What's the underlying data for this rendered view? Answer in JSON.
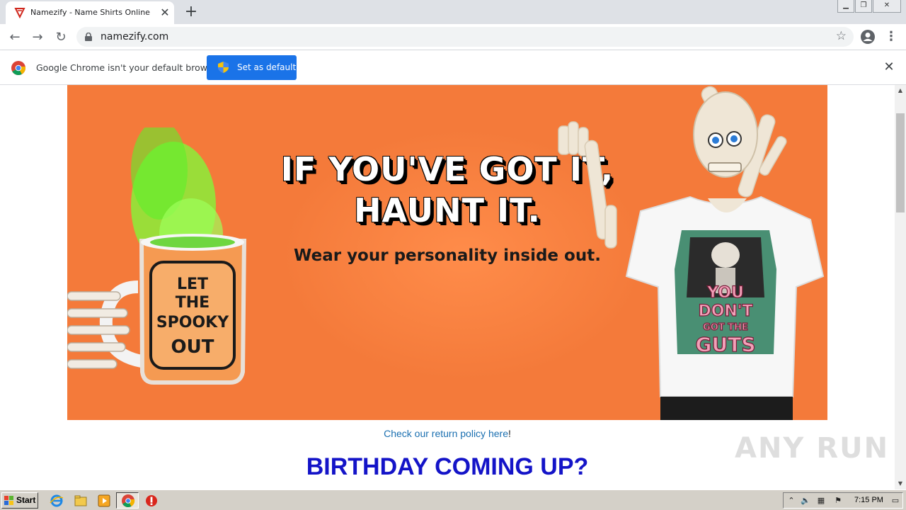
{
  "browser": {
    "tab_title": "Namezify - Name Shirts Online",
    "url": "namezify.com",
    "infobar_text": "Google Chrome isn't your default browser",
    "set_default_label": "Set as default"
  },
  "hero": {
    "headline_line1": "IF YOU'VE GOT IT,",
    "headline_line2": "HAUNT IT.",
    "subhead": "Wear your personality inside out.",
    "mug_text": [
      "LET",
      "THE",
      "SPOOKY",
      "OUT"
    ],
    "shirt_text": [
      "YOU",
      "DON'T",
      "GOT THE",
      "GUTS"
    ]
  },
  "page": {
    "return_prefix": "Check our return policy ",
    "return_link": "here",
    "return_suffix": "!",
    "birthday_heading": "BIRTHDAY COMING UP?"
  },
  "watermark": "ANY RUN",
  "taskbar": {
    "start_label": "Start",
    "clock": "7:15 PM"
  },
  "colors": {
    "hero_bg": "#f47a3a",
    "birthday_blue": "#1414c8",
    "link_blue": "#1a6fb0",
    "chrome_blue": "#1a73e8"
  }
}
